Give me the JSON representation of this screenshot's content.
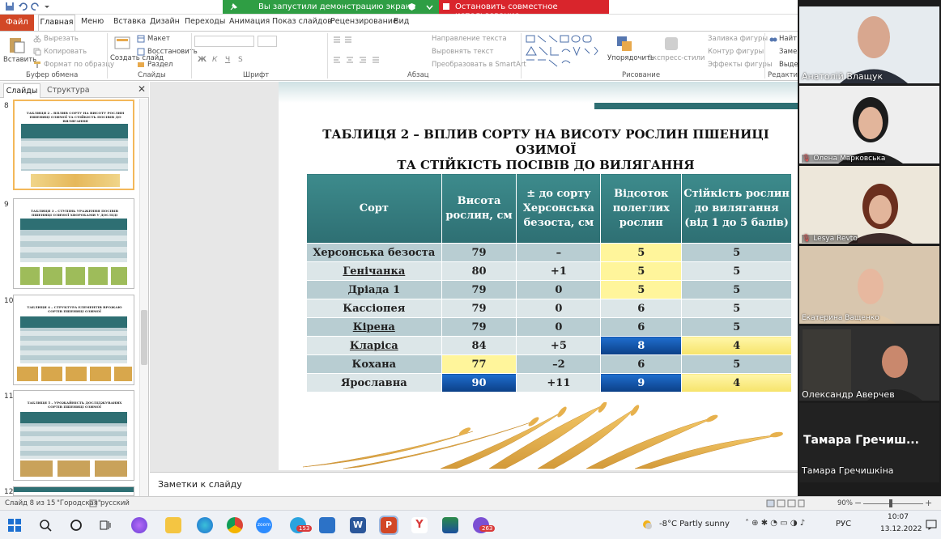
{
  "share": {
    "demo_text": "Вы запустили демонстрацию экрана",
    "stop_text": "Остановить совместное использование"
  },
  "tabs": [
    "Файл",
    "Главная",
    "Меню",
    "Вставка",
    "Дизайн",
    "Переходы",
    "Анимация",
    "Показ слайдов",
    "Рецензирование",
    "Вид"
  ],
  "ribbon": {
    "paste": "Вставить",
    "cut": "Вырезать",
    "copy": "Копировать",
    "format_painter": "Формат по образцу",
    "clipboard_group": "Буфер обмена",
    "new_slide": "Создать слайд",
    "layout": "Макет",
    "reset": "Восстановить",
    "section": "Раздел",
    "slides_group": "Слайды",
    "font_group": "Шрифт",
    "text_direction": "Направление текста",
    "align_text": "Выровнять текст",
    "smartart": "Преобразовать в SmartArt",
    "paragraph_group": "Абзац",
    "arrange": "Упорядочить",
    "quick_styles": "Экспресс-стили",
    "shape_fill": "Заливка фигуры",
    "shape_outline": "Контур фигуры",
    "shape_effects": "Эффекты фигуры",
    "drawing_group": "Рисование",
    "find": "Найт",
    "replace": "Заме",
    "select": "Выде",
    "editing_group": "Редактир"
  },
  "pane": {
    "tab_slides": "Слайды",
    "tab_outline": "Структура",
    "slides": [
      {
        "num": "8",
        "title": "ТАБЛИЦЯ 2 – ВПЛИВ СОРТУ НА ВИСОТУ РОСЛИН ПШЕНИЦІ ОЗИМОЇ ТА СТІЙКІСТЬ ПОСІВІВ ДО ВИЛЯГАННЯ"
      },
      {
        "num": "9",
        "title": "ТАБЛИЦЯ 3 – СТУПІНЬ УРАЖЕННЯ ПОСІВІВ ПШЕНИЦІ ОЗИМОЇ ХВОРОБАМИ У ДОСЛІДІ"
      },
      {
        "num": "10",
        "title": "ТАБЛИЦЯ 4 – СТРУКТУРА ЕЛЕМЕНТІВ ВРОЖАЮ СОРТІВ ПШЕНИЦІ ОЗИМОЇ"
      },
      {
        "num": "11",
        "title": "ТАБЛИЦЯ 5 – УРОЖАЙНІСТЬ ДОСЛІДЖУВАНИХ СОРТІВ ПШЕНИЦІ ОЗИМОЇ"
      },
      {
        "num": "12",
        "title": ""
      }
    ]
  },
  "slide": {
    "title_line1": "ТАБЛИЦЯ 2 – ВПЛИВ СОРТУ НА ВИСОТУ РОСЛИН ПШЕНИЦІ ОЗИМОЇ",
    "title_line2": "ТА СТІЙКІСТЬ ПОСІВІВ ДО ВИЛЯГАННЯ",
    "headers": [
      "Сорт",
      "Висота рослин, см",
      "± до сорту Херсонська безоста, см",
      "Відсоток полеглих рослин",
      "Стійкість рослин до вилягання (від 1 до 5 балів)"
    ],
    "rows": [
      [
        "Херсонська безоста",
        "79",
        "–",
        "5",
        "5"
      ],
      [
        "Генічанка",
        "80",
        "+1",
        "5",
        "5"
      ],
      [
        "Дріада 1",
        "79",
        "0",
        "5",
        "5"
      ],
      [
        "Кассіопея",
        "79",
        "0",
        "6",
        "5"
      ],
      [
        "Кірена",
        "79",
        "0",
        "6",
        "5"
      ],
      [
        "Кларіса",
        "84",
        "+5",
        "8",
        "4"
      ],
      [
        "Кохана",
        "77",
        "–2",
        "6",
        "5"
      ],
      [
        "Ярославна",
        "90",
        "+11",
        "9",
        "4"
      ]
    ]
  },
  "notes": {
    "placeholder": "Заметки к слайду"
  },
  "status": {
    "slide_of": "Слайд 8 из 15",
    "theme": "\"Городская\"",
    "language": "русский",
    "zoom": "90%"
  },
  "taskbar": {
    "weather": "-8°C  Partly sunny",
    "lang": "РУС",
    "time": "10:07",
    "date": "13.12.2022",
    "badge_tg": "153",
    "badge_viber": "263"
  },
  "participants": [
    {
      "name": "Анатолій  Влащук"
    },
    {
      "name": "Олена Марковська"
    },
    {
      "name": "Lesya Revto"
    },
    {
      "name": "Екатерина Ващенко"
    },
    {
      "name": "Олександр Аверчев"
    },
    {
      "name": "Тамара  Гречиш...",
      "sub": "Тамара Гречишкіна"
    }
  ],
  "colors": {
    "file_tab": "#d24726",
    "share_green": "#2f9e44",
    "stop_red": "#d9252c",
    "table_header": "#2e6f73",
    "highlight_yellow": "#fff59b",
    "highlight_blue": "#0b3f86"
  }
}
